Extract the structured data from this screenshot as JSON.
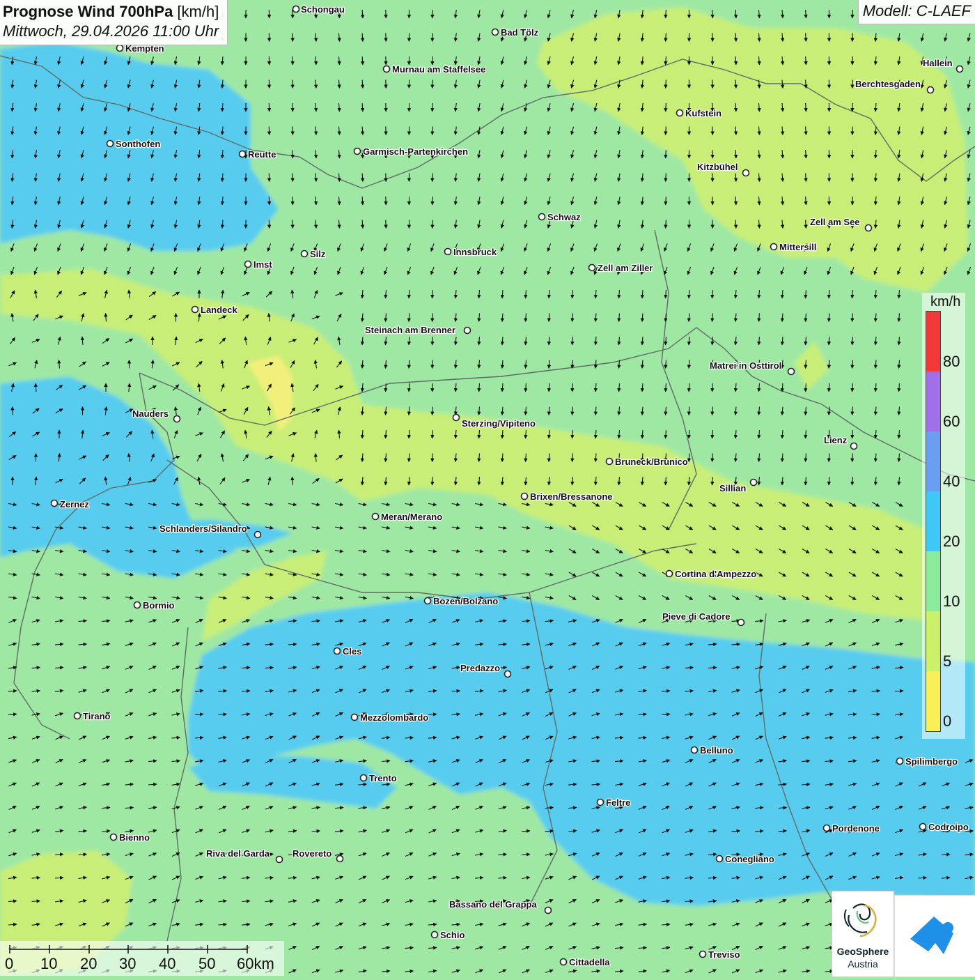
{
  "header": {
    "title_bold": "Prognose Wind 700hPa",
    "title_unit": " [km/h]",
    "datetime": "Mittwoch, 29.04.2026 11:00 Uhr",
    "model": "Modell: C-LAEF"
  },
  "legend": {
    "unit": "km/h",
    "labels": [
      "80",
      "60",
      "40",
      "20",
      "10",
      "5",
      "0"
    ],
    "colors": [
      "#f23a3a",
      "#a070e8",
      "#6a9ef0",
      "#40c8f4",
      "#8aec9c",
      "#ccf06a",
      "#f8f05a"
    ]
  },
  "scalebar": {
    "labels": [
      "0",
      "10",
      "20",
      "30",
      "40",
      "50",
      "60km"
    ]
  },
  "branding": {
    "org_name": "GeoSphere",
    "org_sub": "Austria",
    "icons": [
      "geosphere-logo-icon",
      "app-logo-icon"
    ]
  },
  "cities": [
    {
      "name": "Schongau"
    },
    {
      "name": "Bad Tölz"
    },
    {
      "name": "Kempten"
    },
    {
      "name": "Hallein"
    },
    {
      "name": "Murnau am Staffelsee"
    },
    {
      "name": "Berchtesgaden"
    },
    {
      "name": "Kufstein"
    },
    {
      "name": "Sonthofen"
    },
    {
      "name": "Reutte"
    },
    {
      "name": "Garmisch-Partenkirchen"
    },
    {
      "name": "Kitzbühel"
    },
    {
      "name": "Schwaz"
    },
    {
      "name": "Zell am See"
    },
    {
      "name": "Mittersill"
    },
    {
      "name": "Innsbruck"
    },
    {
      "name": "Silz"
    },
    {
      "name": "Imst"
    },
    {
      "name": "Zell am Ziller"
    },
    {
      "name": "Landeck"
    },
    {
      "name": "Steinach am Brenner"
    },
    {
      "name": "Matrei in Osttirol"
    },
    {
      "name": "Nauders"
    },
    {
      "name": "Sterzing/Vipiteno"
    },
    {
      "name": "Lienz"
    },
    {
      "name": "Bruneck/Brunico"
    },
    {
      "name": "Sillian"
    },
    {
      "name": "Zernez"
    },
    {
      "name": "Brixen/Bressanone"
    },
    {
      "name": "Meran/Merano"
    },
    {
      "name": "Schlanders/Silandro"
    },
    {
      "name": "Cortina d'Ampezzo"
    },
    {
      "name": "Bormio"
    },
    {
      "name": "Bozen/Bolzano"
    },
    {
      "name": "Pieve di Cadore"
    },
    {
      "name": "Cles"
    },
    {
      "name": "Predazzo"
    },
    {
      "name": "Tirano"
    },
    {
      "name": "Mezzolombardo"
    },
    {
      "name": "Belluno"
    },
    {
      "name": "Spilimbergo"
    },
    {
      "name": "Trento"
    },
    {
      "name": "Feltre"
    },
    {
      "name": "Bienno"
    },
    {
      "name": "Pordenone"
    },
    {
      "name": "Codroipo"
    },
    {
      "name": "Riva del Garda"
    },
    {
      "name": "Rovereto"
    },
    {
      "name": "Conegliano"
    },
    {
      "name": "Bassano del Grappa"
    },
    {
      "name": "Schio"
    },
    {
      "name": "Treviso"
    },
    {
      "name": "Cittadella"
    }
  ]
}
